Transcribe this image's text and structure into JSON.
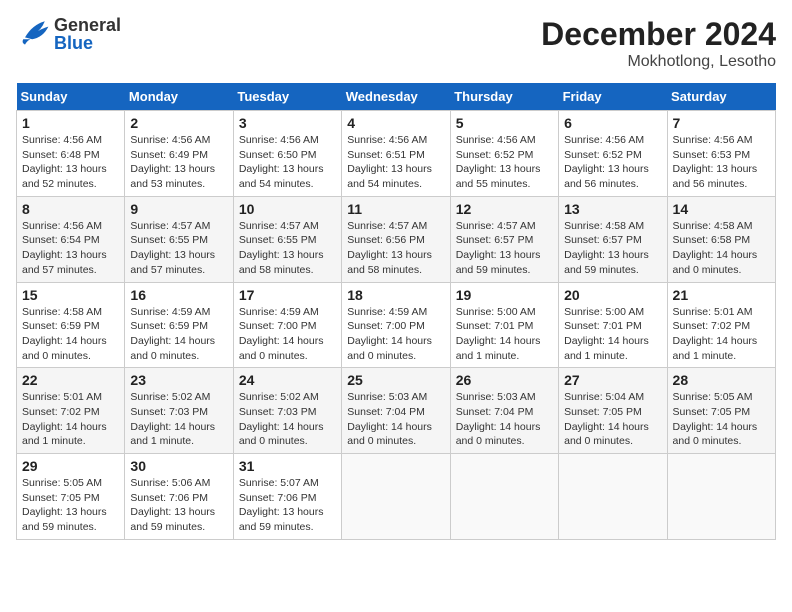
{
  "header": {
    "title": "December 2024",
    "subtitle": "Mokhotlong, Lesotho",
    "logo_general": "General",
    "logo_blue": "Blue"
  },
  "calendar": {
    "days_of_week": [
      "Sunday",
      "Monday",
      "Tuesday",
      "Wednesday",
      "Thursday",
      "Friday",
      "Saturday"
    ],
    "weeks": [
      [
        {
          "day": "1",
          "sunrise": "Sunrise: 4:56 AM",
          "sunset": "Sunset: 6:48 PM",
          "daylight": "Daylight: 13 hours and 52 minutes."
        },
        {
          "day": "2",
          "sunrise": "Sunrise: 4:56 AM",
          "sunset": "Sunset: 6:49 PM",
          "daylight": "Daylight: 13 hours and 53 minutes."
        },
        {
          "day": "3",
          "sunrise": "Sunrise: 4:56 AM",
          "sunset": "Sunset: 6:50 PM",
          "daylight": "Daylight: 13 hours and 54 minutes."
        },
        {
          "day": "4",
          "sunrise": "Sunrise: 4:56 AM",
          "sunset": "Sunset: 6:51 PM",
          "daylight": "Daylight: 13 hours and 54 minutes."
        },
        {
          "day": "5",
          "sunrise": "Sunrise: 4:56 AM",
          "sunset": "Sunset: 6:52 PM",
          "daylight": "Daylight: 13 hours and 55 minutes."
        },
        {
          "day": "6",
          "sunrise": "Sunrise: 4:56 AM",
          "sunset": "Sunset: 6:52 PM",
          "daylight": "Daylight: 13 hours and 56 minutes."
        },
        {
          "day": "7",
          "sunrise": "Sunrise: 4:56 AM",
          "sunset": "Sunset: 6:53 PM",
          "daylight": "Daylight: 13 hours and 56 minutes."
        }
      ],
      [
        {
          "day": "8",
          "sunrise": "Sunrise: 4:56 AM",
          "sunset": "Sunset: 6:54 PM",
          "daylight": "Daylight: 13 hours and 57 minutes."
        },
        {
          "day": "9",
          "sunrise": "Sunrise: 4:57 AM",
          "sunset": "Sunset: 6:55 PM",
          "daylight": "Daylight: 13 hours and 57 minutes."
        },
        {
          "day": "10",
          "sunrise": "Sunrise: 4:57 AM",
          "sunset": "Sunset: 6:55 PM",
          "daylight": "Daylight: 13 hours and 58 minutes."
        },
        {
          "day": "11",
          "sunrise": "Sunrise: 4:57 AM",
          "sunset": "Sunset: 6:56 PM",
          "daylight": "Daylight: 13 hours and 58 minutes."
        },
        {
          "day": "12",
          "sunrise": "Sunrise: 4:57 AM",
          "sunset": "Sunset: 6:57 PM",
          "daylight": "Daylight: 13 hours and 59 minutes."
        },
        {
          "day": "13",
          "sunrise": "Sunrise: 4:58 AM",
          "sunset": "Sunset: 6:57 PM",
          "daylight": "Daylight: 13 hours and 59 minutes."
        },
        {
          "day": "14",
          "sunrise": "Sunrise: 4:58 AM",
          "sunset": "Sunset: 6:58 PM",
          "daylight": "Daylight: 14 hours and 0 minutes."
        }
      ],
      [
        {
          "day": "15",
          "sunrise": "Sunrise: 4:58 AM",
          "sunset": "Sunset: 6:59 PM",
          "daylight": "Daylight: 14 hours and 0 minutes."
        },
        {
          "day": "16",
          "sunrise": "Sunrise: 4:59 AM",
          "sunset": "Sunset: 6:59 PM",
          "daylight": "Daylight: 14 hours and 0 minutes."
        },
        {
          "day": "17",
          "sunrise": "Sunrise: 4:59 AM",
          "sunset": "Sunset: 7:00 PM",
          "daylight": "Daylight: 14 hours and 0 minutes."
        },
        {
          "day": "18",
          "sunrise": "Sunrise: 4:59 AM",
          "sunset": "Sunset: 7:00 PM",
          "daylight": "Daylight: 14 hours and 0 minutes."
        },
        {
          "day": "19",
          "sunrise": "Sunrise: 5:00 AM",
          "sunset": "Sunset: 7:01 PM",
          "daylight": "Daylight: 14 hours and 1 minute."
        },
        {
          "day": "20",
          "sunrise": "Sunrise: 5:00 AM",
          "sunset": "Sunset: 7:01 PM",
          "daylight": "Daylight: 14 hours and 1 minute."
        },
        {
          "day": "21",
          "sunrise": "Sunrise: 5:01 AM",
          "sunset": "Sunset: 7:02 PM",
          "daylight": "Daylight: 14 hours and 1 minute."
        }
      ],
      [
        {
          "day": "22",
          "sunrise": "Sunrise: 5:01 AM",
          "sunset": "Sunset: 7:02 PM",
          "daylight": "Daylight: 14 hours and 1 minute."
        },
        {
          "day": "23",
          "sunrise": "Sunrise: 5:02 AM",
          "sunset": "Sunset: 7:03 PM",
          "daylight": "Daylight: 14 hours and 1 minute."
        },
        {
          "day": "24",
          "sunrise": "Sunrise: 5:02 AM",
          "sunset": "Sunset: 7:03 PM",
          "daylight": "Daylight: 14 hours and 0 minutes."
        },
        {
          "day": "25",
          "sunrise": "Sunrise: 5:03 AM",
          "sunset": "Sunset: 7:04 PM",
          "daylight": "Daylight: 14 hours and 0 minutes."
        },
        {
          "day": "26",
          "sunrise": "Sunrise: 5:03 AM",
          "sunset": "Sunset: 7:04 PM",
          "daylight": "Daylight: 14 hours and 0 minutes."
        },
        {
          "day": "27",
          "sunrise": "Sunrise: 5:04 AM",
          "sunset": "Sunset: 7:05 PM",
          "daylight": "Daylight: 14 hours and 0 minutes."
        },
        {
          "day": "28",
          "sunrise": "Sunrise: 5:05 AM",
          "sunset": "Sunset: 7:05 PM",
          "daylight": "Daylight: 14 hours and 0 minutes."
        }
      ],
      [
        {
          "day": "29",
          "sunrise": "Sunrise: 5:05 AM",
          "sunset": "Sunset: 7:05 PM",
          "daylight": "Daylight: 13 hours and 59 minutes."
        },
        {
          "day": "30",
          "sunrise": "Sunrise: 5:06 AM",
          "sunset": "Sunset: 7:06 PM",
          "daylight": "Daylight: 13 hours and 59 minutes."
        },
        {
          "day": "31",
          "sunrise": "Sunrise: 5:07 AM",
          "sunset": "Sunset: 7:06 PM",
          "daylight": "Daylight: 13 hours and 59 minutes."
        },
        null,
        null,
        null,
        null
      ]
    ]
  }
}
